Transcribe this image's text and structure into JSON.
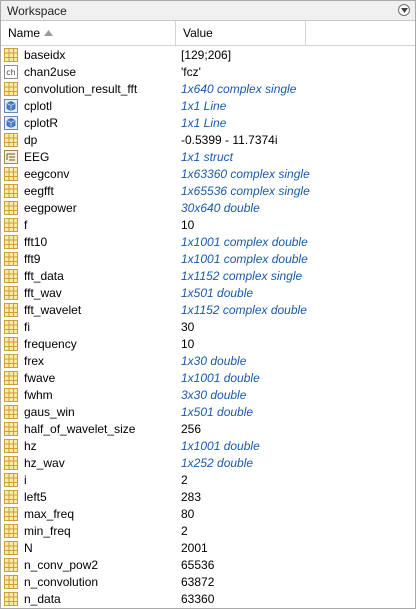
{
  "panel": {
    "title": "Workspace"
  },
  "header": {
    "name_label": "Name",
    "value_label": "Value"
  },
  "variables": [
    {
      "name": "baseidx",
      "value": "[129;206]",
      "icon": "matrix-icon",
      "meta": false
    },
    {
      "name": "chan2use",
      "value": "'fcz'",
      "icon": "char-icon",
      "meta": false
    },
    {
      "name": "convolution_result_fft",
      "value": "1x640 complex single",
      "icon": "matrix-icon",
      "meta": true
    },
    {
      "name": "cplotl",
      "value": "1x1 Line",
      "icon": "object-icon",
      "meta": true
    },
    {
      "name": "cplotR",
      "value": "1x1 Line",
      "icon": "object-icon",
      "meta": true
    },
    {
      "name": "dp",
      "value": "-0.5399 - 11.7374i",
      "icon": "matrix-icon",
      "meta": false
    },
    {
      "name": "EEG",
      "value": "1x1 struct",
      "icon": "struct-icon",
      "meta": true
    },
    {
      "name": "eegconv",
      "value": "1x63360 complex single",
      "icon": "matrix-icon",
      "meta": true
    },
    {
      "name": "eegfft",
      "value": "1x65536 complex single",
      "icon": "matrix-icon",
      "meta": true
    },
    {
      "name": "eegpower",
      "value": "30x640 double",
      "icon": "matrix-icon",
      "meta": true
    },
    {
      "name": "f",
      "value": "10",
      "icon": "matrix-icon",
      "meta": false
    },
    {
      "name": "fft10",
      "value": "1x1001 complex double",
      "icon": "matrix-icon",
      "meta": true
    },
    {
      "name": "fft9",
      "value": "1x1001 complex double",
      "icon": "matrix-icon",
      "meta": true
    },
    {
      "name": "fft_data",
      "value": "1x1152 complex single",
      "icon": "matrix-icon",
      "meta": true
    },
    {
      "name": "fft_wav",
      "value": "1x501 double",
      "icon": "matrix-icon",
      "meta": true
    },
    {
      "name": "fft_wavelet",
      "value": "1x1152 complex double",
      "icon": "matrix-icon",
      "meta": true
    },
    {
      "name": "fi",
      "value": "30",
      "icon": "matrix-icon",
      "meta": false
    },
    {
      "name": "frequency",
      "value": "10",
      "icon": "matrix-icon",
      "meta": false
    },
    {
      "name": "frex",
      "value": "1x30 double",
      "icon": "matrix-icon",
      "meta": true
    },
    {
      "name": "fwave",
      "value": "1x1001 double",
      "icon": "matrix-icon",
      "meta": true
    },
    {
      "name": "fwhm",
      "value": "3x30 double",
      "icon": "matrix-icon",
      "meta": true
    },
    {
      "name": "gaus_win",
      "value": "1x501 double",
      "icon": "matrix-icon",
      "meta": true
    },
    {
      "name": "half_of_wavelet_size",
      "value": "256",
      "icon": "matrix-icon",
      "meta": false
    },
    {
      "name": "hz",
      "value": "1x1001 double",
      "icon": "matrix-icon",
      "meta": true
    },
    {
      "name": "hz_wav",
      "value": "1x252 double",
      "icon": "matrix-icon",
      "meta": true
    },
    {
      "name": "i",
      "value": "2",
      "icon": "matrix-icon",
      "meta": false
    },
    {
      "name": "left5",
      "value": "283",
      "icon": "matrix-icon",
      "meta": false
    },
    {
      "name": "max_freq",
      "value": "80",
      "icon": "matrix-icon",
      "meta": false
    },
    {
      "name": "min_freq",
      "value": "2",
      "icon": "matrix-icon",
      "meta": false
    },
    {
      "name": "N",
      "value": "2001",
      "icon": "matrix-icon",
      "meta": false
    },
    {
      "name": "n_conv_pow2",
      "value": "65536",
      "icon": "matrix-icon",
      "meta": false
    },
    {
      "name": "n_convolution",
      "value": "63872",
      "icon": "matrix-icon",
      "meta": false
    },
    {
      "name": "n_data",
      "value": "63360",
      "icon": "matrix-icon",
      "meta": false
    }
  ],
  "colors": {
    "meta_value": "#1a5aa8",
    "matrix_icon_fill": "#fde9a8",
    "matrix_icon_border": "#c8a03c",
    "object_icon": "#4a7fc8"
  }
}
